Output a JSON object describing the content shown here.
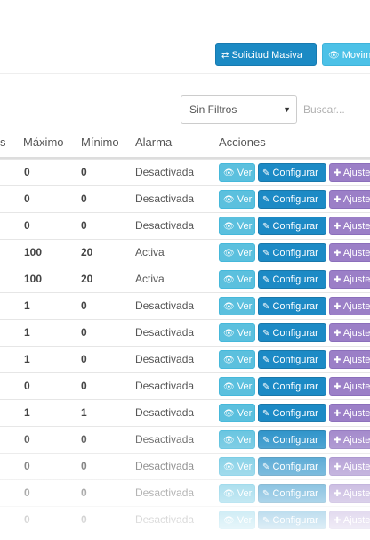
{
  "toolbar": {
    "solicitud_label": "Solicitud Masiva",
    "movim_label": "Movim"
  },
  "filter": {
    "selected": "Sin Filtros",
    "search_placeholder": "Buscar..."
  },
  "table": {
    "headers": {
      "partial": "s",
      "maximo": "Máximo",
      "minimo": "Mínimo",
      "alarma": "Alarma",
      "acciones": "Acciones"
    },
    "actions": {
      "ver": "Ver",
      "configurar": "Configurar",
      "ajuste": "Ajuste"
    },
    "rows": [
      {
        "max": "0",
        "min": "0",
        "alarma": "Desactivada"
      },
      {
        "max": "0",
        "min": "0",
        "alarma": "Desactivada"
      },
      {
        "max": "0",
        "min": "0",
        "alarma": "Desactivada"
      },
      {
        "max": "100",
        "min": "20",
        "alarma": "Activa"
      },
      {
        "max": "100",
        "min": "20",
        "alarma": "Activa"
      },
      {
        "max": "1",
        "min": "0",
        "alarma": "Desactivada"
      },
      {
        "max": "1",
        "min": "0",
        "alarma": "Desactivada"
      },
      {
        "max": "1",
        "min": "0",
        "alarma": "Desactivada"
      },
      {
        "max": "0",
        "min": "0",
        "alarma": "Desactivada"
      },
      {
        "max": "1",
        "min": "1",
        "alarma": "Desactivada"
      },
      {
        "max": "0",
        "min": "0",
        "alarma": "Desactivada"
      },
      {
        "max": "0",
        "min": "0",
        "alarma": "Desactivada"
      },
      {
        "max": "0",
        "min": "0",
        "alarma": "Desactivada"
      },
      {
        "max": "0",
        "min": "0",
        "alarma": "Desactivada"
      }
    ]
  }
}
